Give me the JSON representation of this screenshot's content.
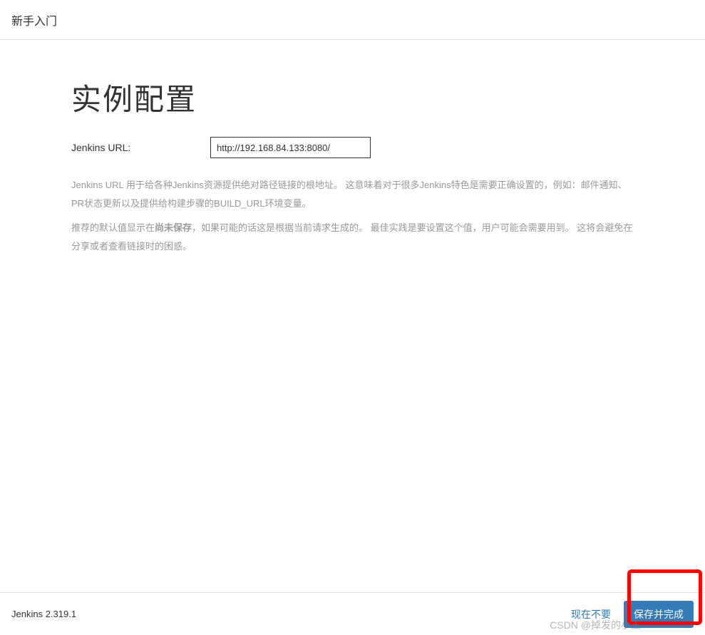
{
  "header": {
    "title": "新手入门"
  },
  "main": {
    "title": "实例配置",
    "form": {
      "url_label": "Jenkins URL:",
      "url_value": "http://192.168.84.133:8080/"
    },
    "description_1_part1": "Jenkins URL 用于给各种Jenkins资源提供绝对路径链接的根地址。 这意味着对于很多Jenkins特色是需要正确设置的，例如：邮件通知、PR状态更新以及提供给构建步骤的BUILD_URL环境变量。",
    "description_2_part1": "推荐的默认值显示在",
    "description_2_strong": "尚未保存",
    "description_2_part2": "，如果可能的话这是根据当前请求生成的。 最佳实践是要设置这个值，用户可能会需要用到。 这将会避免在分享或者查看链接时的困惑。"
  },
  "footer": {
    "version": "Jenkins 2.319.1",
    "skip_label": "现在不要",
    "save_label": "保存并完成"
  },
  "watermark": "CSDN @掉发的小王"
}
